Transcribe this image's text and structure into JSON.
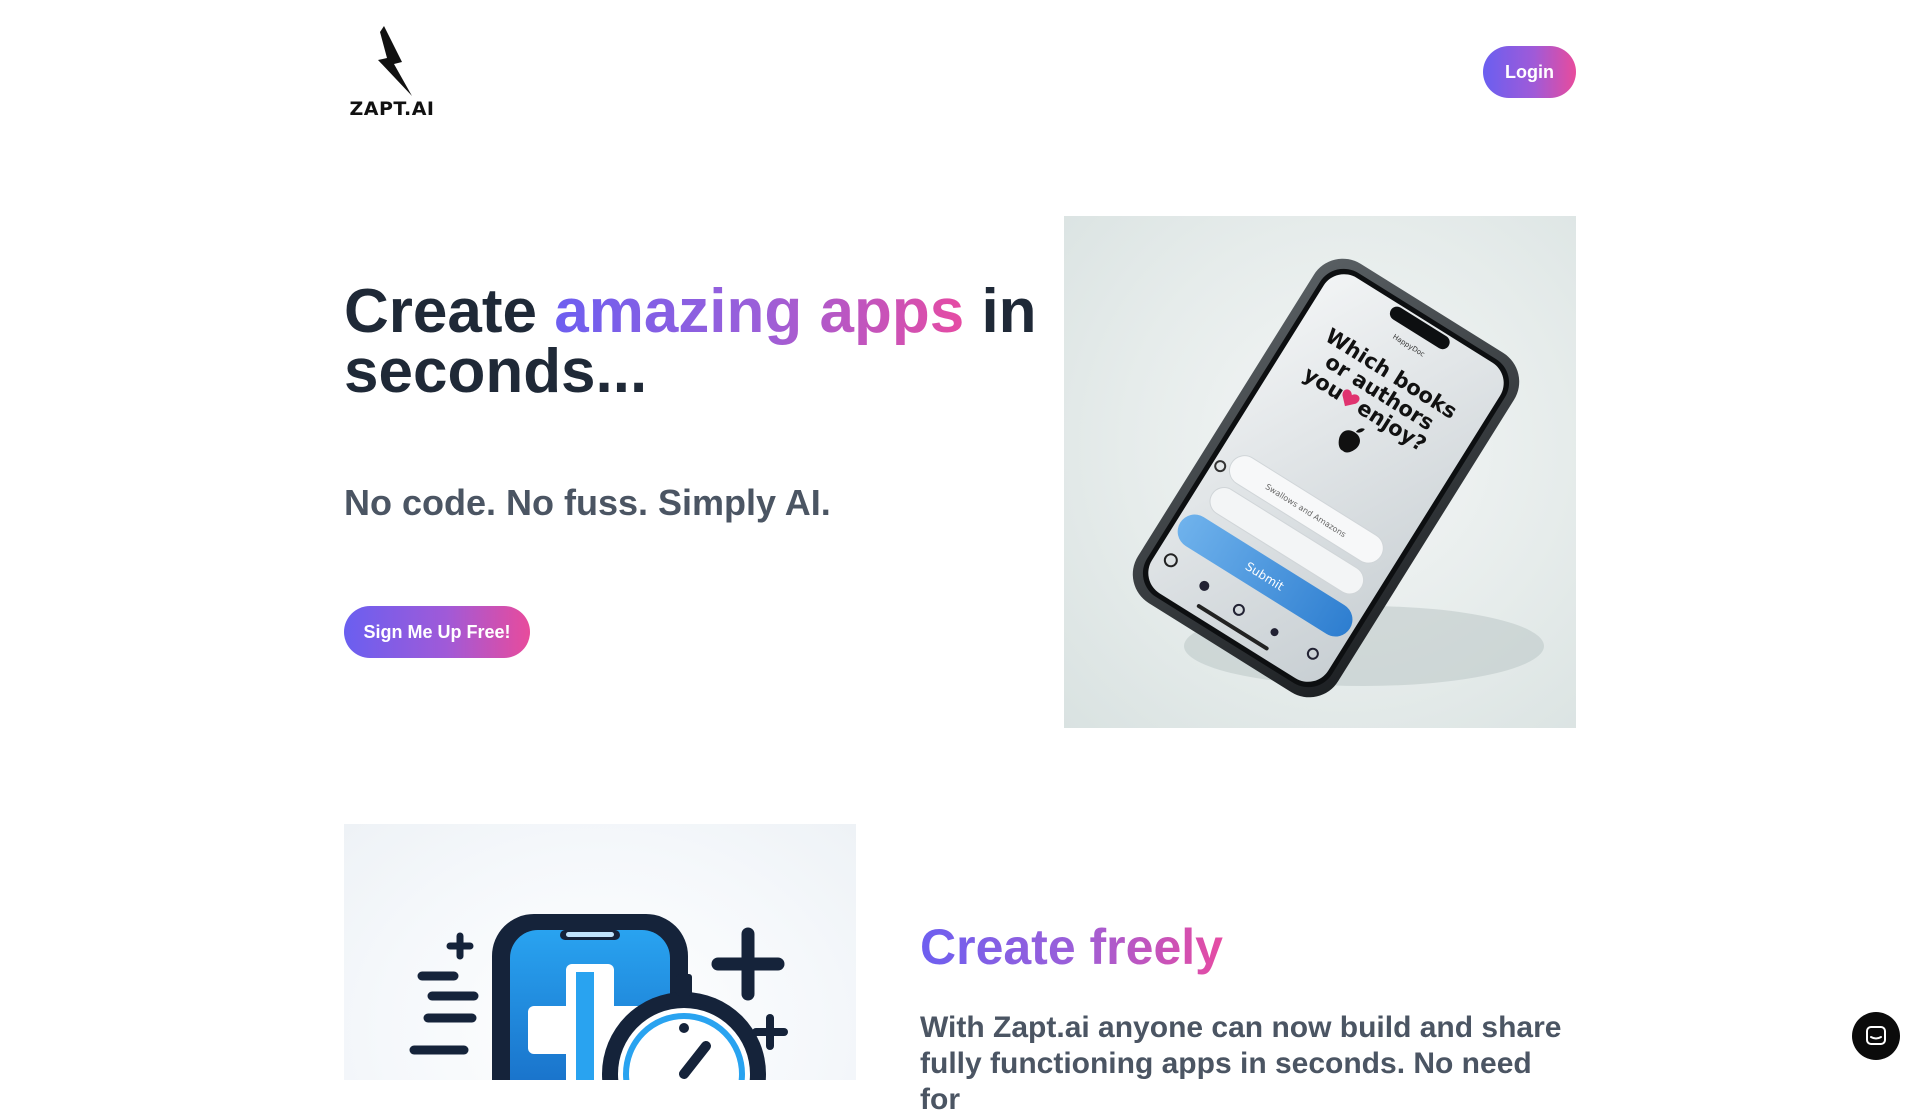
{
  "header": {
    "logo_text": "ZAPT.AI",
    "login_label": "Login"
  },
  "hero": {
    "title_part1": "Create ",
    "title_highlight": "amazing apps",
    "title_part2": " in seconds...",
    "subtitle": "No code. No fuss. Simply AI.",
    "cta_label": "Sign Me Up Free!",
    "phone_screen": {
      "status": "HappyDoc",
      "question": [
        "Which books",
        "or authors",
        "you",
        "enjoy?"
      ],
      "input_value": "Swallows and Amazons",
      "submit_label": "Submit"
    }
  },
  "feature": {
    "title": "Create freely",
    "body": "With Zapt.ai anyone can now build and share fully functioning apps in seconds. No need for"
  },
  "colors": {
    "gradient_start": "#6d5ff0",
    "gradient_end": "#e64ba3",
    "heading": "#1f2937",
    "subtext": "#4b5563"
  },
  "icons": {
    "logo": "lightning-bolt-icon",
    "chat": "chat-bubble-icon"
  }
}
